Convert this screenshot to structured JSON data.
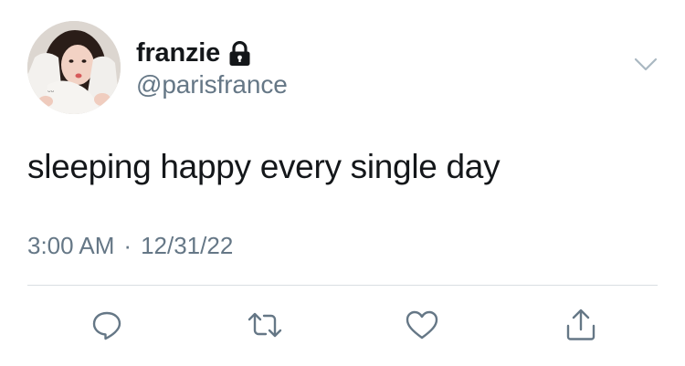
{
  "tweet": {
    "display_name": "franzie",
    "handle": "@parisfrance",
    "protected_icon": "lock-icon",
    "menu_icon": "chevron-down-icon",
    "text": "sleeping happy every single day",
    "time": "3:00 AM",
    "separator": "·",
    "date": "12/31/22"
  },
  "actions": [
    {
      "name": "reply",
      "icon": "reply-icon"
    },
    {
      "name": "retweet",
      "icon": "retweet-icon"
    },
    {
      "name": "like",
      "icon": "heart-icon"
    },
    {
      "name": "share",
      "icon": "share-icon"
    }
  ],
  "colors": {
    "text_primary": "#14171a",
    "text_secondary": "#657786",
    "icon": "#657786",
    "divider": "#d9dee2",
    "background": "#ffffff"
  }
}
